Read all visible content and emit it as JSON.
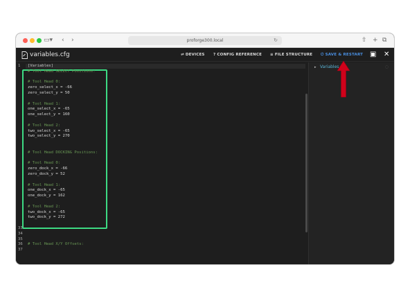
{
  "browser": {
    "url": "proforge300.local",
    "reload_icon": "reload-icon",
    "sidebar_icon": "sidebar-toggle-icon",
    "back_icon": "chevron-left-icon",
    "forward_icon": "chevron-right-icon",
    "share_icon": "share-icon",
    "new_tab_icon": "plus-icon",
    "tabs_icon": "tabs-overview-icon"
  },
  "header": {
    "file_name": "variables.cfg",
    "devices_label": "DEVICES",
    "config_reference_label": "CONFIG REFERENCE",
    "file_structure_label": "FILE STRUCTURE",
    "save_restart_label": "SAVE & RESTART",
    "accent_color": "#4a90e2"
  },
  "editor": {
    "lines": [
      {
        "num": "1",
        "text": "[Variables]",
        "kind": "section"
      },
      {
        "num": "",
        "text": "# Tool Head SELECT Positions:",
        "kind": "comment"
      },
      {
        "num": "",
        "text": "",
        "kind": "code"
      },
      {
        "num": "",
        "text": "# Tool Head 0:",
        "kind": "comment"
      },
      {
        "num": "",
        "text": "zero_select_x = -66",
        "kind": "code"
      },
      {
        "num": "",
        "text": "zero_select_y = 50",
        "kind": "code"
      },
      {
        "num": "",
        "text": "",
        "kind": "code"
      },
      {
        "num": "",
        "text": "# Tool Head 1:",
        "kind": "comment"
      },
      {
        "num": "",
        "text": "one_select_x = -65",
        "kind": "code"
      },
      {
        "num": "",
        "text": "one_select_y = 160",
        "kind": "code"
      },
      {
        "num": "",
        "text": "",
        "kind": "code"
      },
      {
        "num": "",
        "text": "# Tool Head 2:",
        "kind": "comment"
      },
      {
        "num": "",
        "text": "two_select_x = -65",
        "kind": "code"
      },
      {
        "num": "",
        "text": "two_select_y = 270",
        "kind": "code"
      },
      {
        "num": "",
        "text": "",
        "kind": "code"
      },
      {
        "num": "",
        "text": "",
        "kind": "code"
      },
      {
        "num": "",
        "text": "# Tool Head DOCKING Positions:",
        "kind": "comment"
      },
      {
        "num": "",
        "text": "",
        "kind": "code"
      },
      {
        "num": "",
        "text": "# Tool Head 0:",
        "kind": "comment"
      },
      {
        "num": "",
        "text": "zero_dock_x = -66",
        "kind": "code"
      },
      {
        "num": "",
        "text": "zero_dock_y = 52",
        "kind": "code"
      },
      {
        "num": "",
        "text": "",
        "kind": "code"
      },
      {
        "num": "",
        "text": "# Tool Head 1:",
        "kind": "comment"
      },
      {
        "num": "",
        "text": "one_dock_x = -65",
        "kind": "code"
      },
      {
        "num": "",
        "text": "one_dock_y = 162",
        "kind": "code"
      },
      {
        "num": "",
        "text": "",
        "kind": "code"
      },
      {
        "num": "",
        "text": "# Tool Head 2:",
        "kind": "comment"
      },
      {
        "num": "",
        "text": "two_dock_x = -65",
        "kind": "code"
      },
      {
        "num": "",
        "text": "two_dock_y = 272",
        "kind": "code"
      },
      {
        "num": "",
        "text": "",
        "kind": "code"
      },
      {
        "num": "33",
        "text": "",
        "kind": "code"
      },
      {
        "num": "34",
        "text": "",
        "kind": "code"
      },
      {
        "num": "35",
        "text": "",
        "kind": "code"
      },
      {
        "num": "36",
        "text": "# Tool Head X/Y Offsets:",
        "kind": "comment"
      },
      {
        "num": "37",
        "text": "",
        "kind": "code"
      }
    ],
    "highlight_color": "#3ddc84"
  },
  "sidebar": {
    "tree_root_label": "Variables"
  },
  "annotation": {
    "arrow_color": "#d0021b"
  }
}
